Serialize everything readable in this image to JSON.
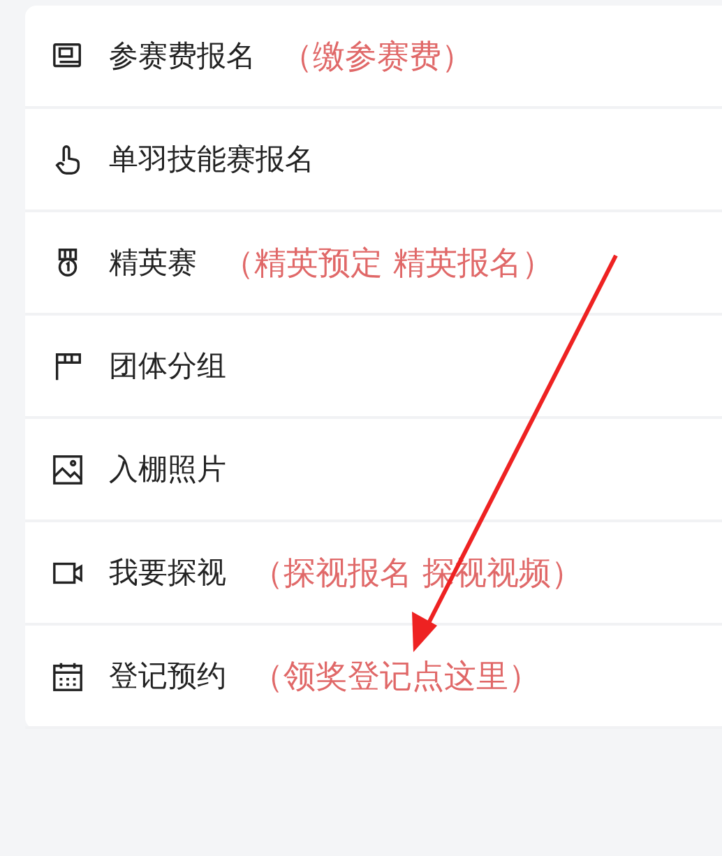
{
  "menu": {
    "items": [
      {
        "label": "参赛费报名",
        "note": "（缴参赛费）"
      },
      {
        "label": "单羽技能赛报名"
      },
      {
        "label": "精英赛",
        "note": "（精英预定 精英报名）"
      },
      {
        "label": "团体分组"
      },
      {
        "label": "入棚照片"
      },
      {
        "label": "我要探视",
        "note": "（探视报名 探视视频）"
      },
      {
        "label": "登记预约",
        "note": "（领奖登记点这里）"
      }
    ]
  }
}
